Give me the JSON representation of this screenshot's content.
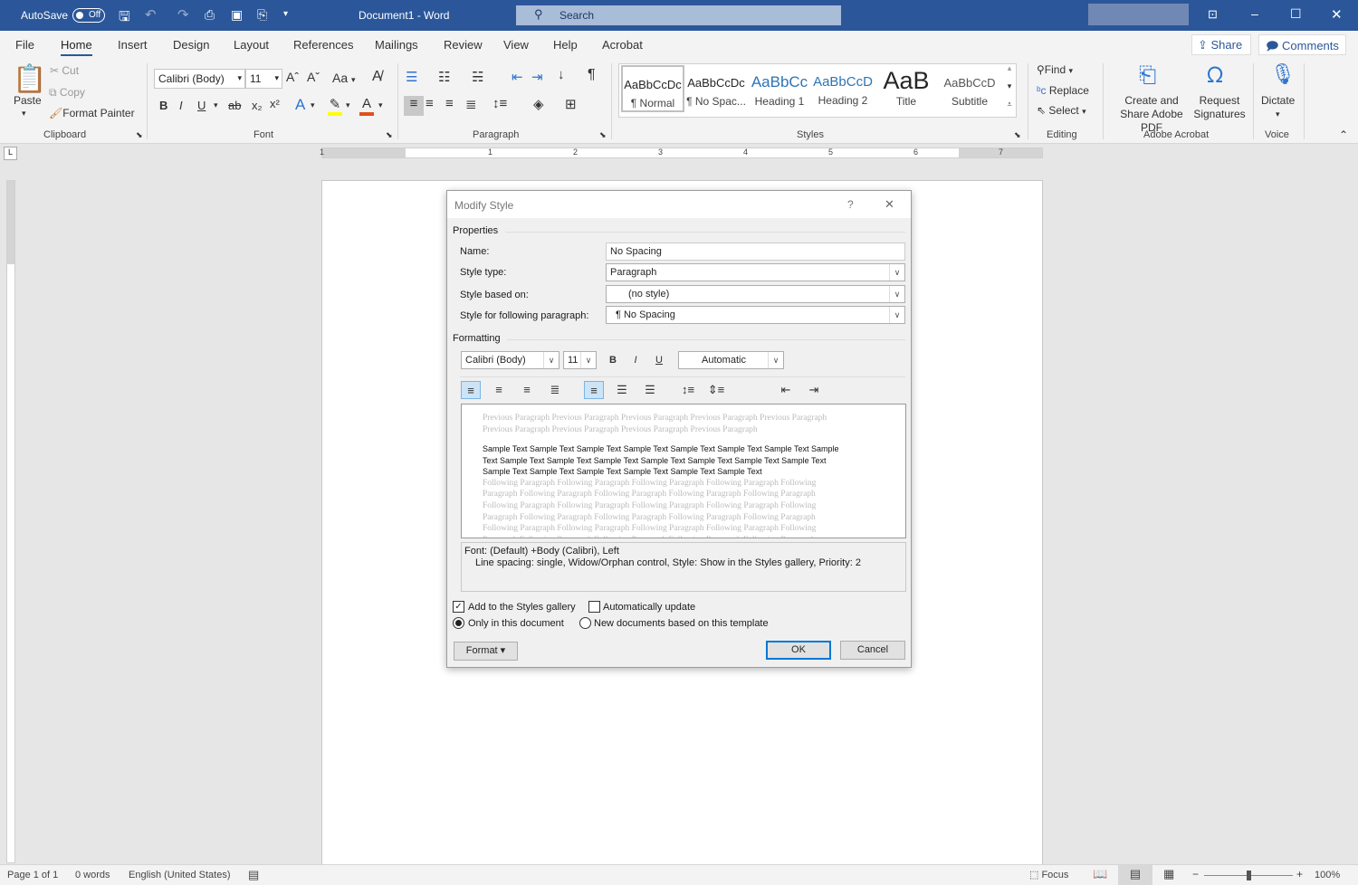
{
  "titlebar": {
    "autosave_label": "AutoSave",
    "autosave_state": "Off",
    "doc_title": "Document1  -  Word",
    "search_placeholder": "Search"
  },
  "tabs": [
    "File",
    "Home",
    "Insert",
    "Design",
    "Layout",
    "References",
    "Mailings",
    "Review",
    "View",
    "Help",
    "Acrobat"
  ],
  "active_tab": "Home",
  "share_label": "Share",
  "comments_label": "Comments",
  "clipboard": {
    "paste": "Paste",
    "cut": "Cut",
    "copy": "Copy",
    "format_painter": "Format Painter",
    "group": "Clipboard"
  },
  "font": {
    "name": "Calibri (Body)",
    "size": "11",
    "group": "Font",
    "case": "Aa",
    "highlight_color": "#ffff00",
    "font_color": "#e0501e"
  },
  "paragraph": {
    "group": "Paragraph"
  },
  "styles": {
    "group": "Styles",
    "items": [
      {
        "preview": "AaBbCcDc",
        "name": "¶ Normal"
      },
      {
        "preview": "AaBbCcDc",
        "name": "¶ No Spac..."
      },
      {
        "preview": "AaBbCc",
        "name": "Heading 1"
      },
      {
        "preview": "AaBbCcD",
        "name": "Heading 2"
      },
      {
        "preview": "AaB",
        "name": "Title"
      },
      {
        "preview": "AaBbCcD",
        "name": "Subtitle"
      }
    ]
  },
  "editing": {
    "find": "Find",
    "replace": "Replace",
    "select": "Select",
    "group": "Editing"
  },
  "acrobat": {
    "create": "Create and Share Adobe PDF",
    "request": "Request Signatures",
    "group": "Adobe Acrobat"
  },
  "voice": {
    "dictate": "Dictate",
    "group": "Voice"
  },
  "ruler": [
    "1",
    "1",
    "2",
    "3",
    "4",
    "5",
    "6",
    "7"
  ],
  "dialog": {
    "title": "Modify Style",
    "help": "?",
    "close": "✕",
    "properties_label": "Properties",
    "name_label": "Name:",
    "name_value": "No Spacing",
    "type_label": "Style type:",
    "type_value": "Paragraph",
    "based_label": "Style based on:",
    "based_value": "(no style)",
    "following_label": "Style for following paragraph:",
    "following_value": "¶  No Spacing",
    "formatting_label": "Formatting",
    "font": "Calibri (Body)",
    "size": "11",
    "bold": "B",
    "italic": "I",
    "underline": "U",
    "color": "Automatic",
    "preview_previous": "Previous Paragraph Previous Paragraph Previous Paragraph Previous Paragraph Previous Paragraph Previous Paragraph Previous Paragraph Previous Paragraph Previous Paragraph",
    "preview_sample": "Sample Text Sample Text Sample Text Sample Text Sample Text Sample Text Sample Text Sample Text Sample Text Sample Text Sample Text Sample Text Sample Text Sample Text Sample Text Sample Text Sample Text Sample Text Sample Text Sample Text Sample Text",
    "preview_following": "Following Paragraph Following Paragraph Following Paragraph Following Paragraph Following Paragraph Following Paragraph Following Paragraph Following Paragraph Following Paragraph Following Paragraph Following Paragraph Following Paragraph Following Paragraph Following Paragraph Following Paragraph Following Paragraph Following Paragraph Following Paragraph Following Paragraph Following Paragraph Following Paragraph Following Paragraph Following Paragraph Following Paragraph Following Paragraph Following Paragraph Following Paragraph Following Paragraph Following Paragraph Following Paragraph",
    "description_line1": "Font: (Default) +Body (Calibri), Left",
    "description_line2": "Line spacing:  single, Widow/Orphan control, Style: Show in the Styles gallery, Priority: 2",
    "add_gallery": "Add to the Styles gallery",
    "add_gallery_checked": true,
    "auto_update": "Automatically update",
    "auto_update_checked": false,
    "only_doc": "Only in this document",
    "new_docs": "New documents based on this template",
    "selected_scope": "Only in this document",
    "format_button": "Format ▾",
    "ok": "OK",
    "cancel": "Cancel"
  },
  "status": {
    "page": "Page 1 of 1",
    "words": "0 words",
    "language": "English (United States)",
    "focus": "Focus",
    "zoom": "100%",
    "zoom_level": 100
  }
}
